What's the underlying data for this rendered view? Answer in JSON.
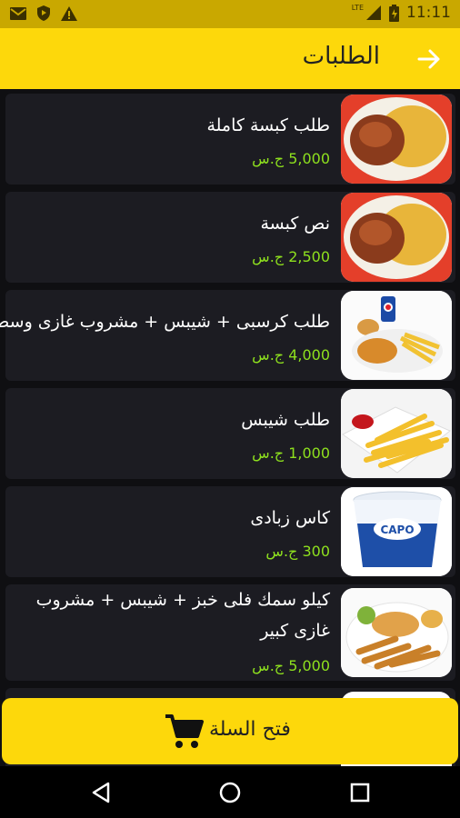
{
  "status_bar": {
    "time": "11:11",
    "network_label": "LTE",
    "icons": [
      "gmail-icon",
      "shield-icon",
      "warning-icon",
      "signal-icon",
      "battery-icon"
    ]
  },
  "app_bar": {
    "title": "الطلبات",
    "back_icon": "arrow-icon"
  },
  "orders": [
    {
      "name": "طلب كبسة كاملة",
      "price": "5,000 ج.س",
      "image": "kabsa-plate"
    },
    {
      "name": "نص كبسة",
      "price": "2,500 ج.س",
      "image": "kabsa-plate"
    },
    {
      "name": "طلب كرسبى + شيبس + مشروب غازى وسط",
      "price": "4,000 ج.س",
      "image": "crispy-meal"
    },
    {
      "name": "طلب شيبس",
      "price": "1,000 ج.س",
      "image": "fries"
    },
    {
      "name": "كاس زبادى",
      "price": "300 ج.س",
      "image": "yogurt-cup"
    },
    {
      "name": "كيلو سمك فلى خبز + شيبس + مشروب غازى كبير",
      "price": "5,000 ج.س",
      "image": "fish-platter"
    }
  ],
  "product_text": {
    "yogurt_brand": "CAPO",
    "drink_brand": "pepsi"
  },
  "cart_button": {
    "label": "فتح السلة",
    "icon": "cart-icon"
  },
  "nav_bar": {
    "icons": [
      "back-triangle-icon",
      "home-circle-icon",
      "recents-square-icon"
    ]
  },
  "colors": {
    "accent": "#fdd80b",
    "status_bar": "#c9a800",
    "card": "#1c1c22",
    "price": "#8ee01e"
  }
}
